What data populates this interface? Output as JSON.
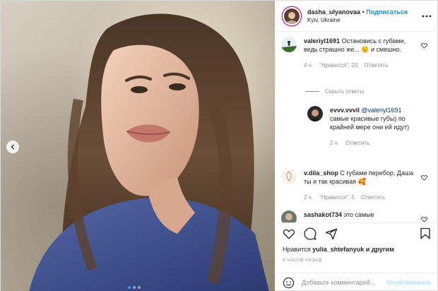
{
  "header": {
    "username": "dasha_ulyanovaa",
    "separator": "•",
    "follow_label": "Подписаться",
    "location": "Kyiv, Ukraine"
  },
  "photo": {
    "description": "Portrait photo of a woman with long brown hair wearing a blue monogram shirt",
    "carousel_count": 3,
    "active_index": 0
  },
  "comments": [
    {
      "username": "valeriyl1691",
      "text": "Остановись с губами, ведь страшно же... 😟 и смешно.",
      "time": "4 ч.",
      "likes": "\"Нравится\": 20",
      "reply": "Ответить"
    },
    {
      "username": "evvv.vvvil",
      "mention": "@valeriyl1691",
      "text": "самые красивые губы) по крайней мере они ей идут)",
      "time": "2 ч.",
      "reply": "Ответить"
    },
    {
      "username": "v.dila_shop",
      "text": "С губами перебор, Даша ты и так красивая 🥰",
      "time": "2 ч.",
      "likes": "\"Нравится\": 5",
      "reply": "Ответить"
    },
    {
      "username": "sashakot734",
      "text": "это самые"
    }
  ],
  "hide_replies_label": "Скрыть ответы",
  "liked_by": {
    "prefix": "Нравится",
    "user": "yulia_shtefanyuk",
    "suffix": "и другим"
  },
  "timestamp": "5 ЧАСОВ НАЗАД",
  "add_comment": {
    "placeholder": "Добавьте комментарий...",
    "publish_label": "Опубликовать"
  },
  "colors": {
    "accent": "#0095f6",
    "muted": "#8e8e8e",
    "publish_disabled": "#b2dffc",
    "carousel_active": "#3897f0"
  }
}
